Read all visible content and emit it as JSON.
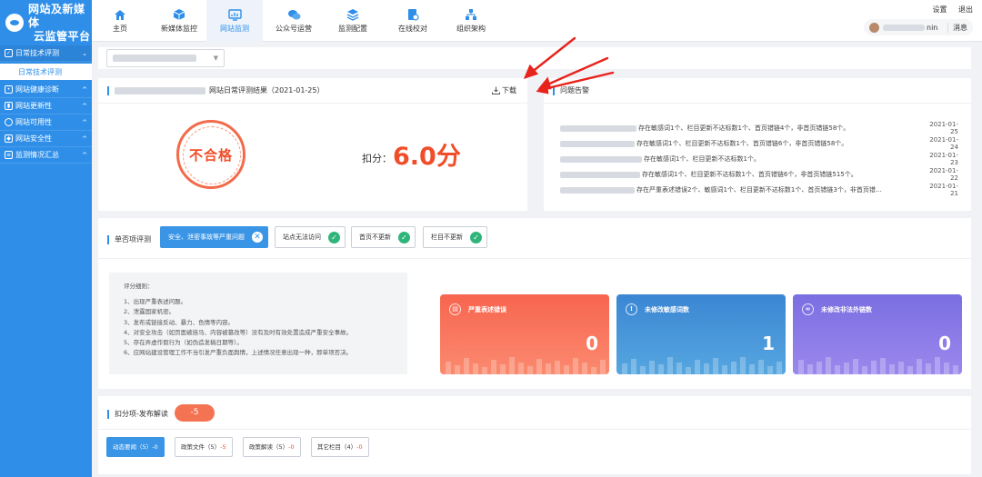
{
  "brand": {
    "line1": "网站及新媒体",
    "line2": "云监管平台"
  },
  "sidebar": {
    "groups": [
      {
        "label": "日常技术评测",
        "icon": "check-circle-icon",
        "expanded": true
      },
      {
        "label": "网站健康诊断",
        "icon": "user-icon"
      },
      {
        "label": "网站更新性",
        "icon": "chart-icon"
      },
      {
        "label": "网站可用性",
        "icon": "circle-icon"
      },
      {
        "label": "网站安全性",
        "icon": "shield-icon"
      },
      {
        "label": "监测情况汇总",
        "icon": "list-icon"
      }
    ],
    "active_sub": "日常技术评测"
  },
  "topnav": {
    "tabs": [
      {
        "label": "主页",
        "icon": "home-icon"
      },
      {
        "label": "新媒体监控",
        "icon": "cube-icon"
      },
      {
        "label": "网站监测",
        "icon": "monitor-icon",
        "active": true
      },
      {
        "label": "公众号运营",
        "icon": "wechat-icon"
      },
      {
        "label": "监测配置",
        "icon": "layers-icon"
      },
      {
        "label": "在线校对",
        "icon": "proofread-icon"
      },
      {
        "label": "组织架构",
        "icon": "org-chart-icon"
      }
    ],
    "settings": "设置",
    "logout": "退出",
    "user_suffix": "nin",
    "messages": "消息"
  },
  "result": {
    "title_suffix": "网站日常评测结果（2021-01-25）",
    "download": "下载",
    "stamp": "不合格",
    "score_label": "扣分：",
    "score_value": "6.0分"
  },
  "alerts": {
    "title": "问题告警",
    "rows": [
      {
        "text": "存在敏感词1个、栏目更新不达标数1个、首页错链4个，非首页错链58个。",
        "date": "2021-01-25"
      },
      {
        "text": "存在敏感词1个、栏目更新不达标数1个、首页错链6个，非首页错链58个。",
        "date": "2021-01-24"
      },
      {
        "text": "存在敏感词1个、栏目更新不达标数1个。",
        "date": "2021-01-23"
      },
      {
        "text": "存在敏感词1个、栏目更新不达标数1个、首页错链6个，非首页错链515个。",
        "date": "2021-01-22"
      },
      {
        "text": "存在严重表述错误2个、敏感词1个、栏目更新不达标数1个、首页错链3个，非首页错...",
        "date": "2021-01-21"
      }
    ]
  },
  "single": {
    "title": "单否项评测",
    "chips": [
      {
        "label": "安全、泄密事故等严重问题",
        "status": "fail"
      },
      {
        "label": "站点无法访问",
        "status": "pass"
      },
      {
        "label": "首页不更新",
        "status": "pass"
      },
      {
        "label": "栏目不更新",
        "status": "pass"
      }
    ],
    "rules_title": "评分细则：",
    "rules": [
      "1、出现严重表述问题。",
      "2、泄露国家机密。",
      "3、发布或链接反动、暴力、色情等内容。",
      "4、对安全攻击（如页面被挂马、内容被篡改等）没有及时有效处置造成严重安全事故。",
      "5、存在弄虚作假行为（如伪造发稿日期等）。",
      "6、应网站建设管理工作不当引发严重负面舆情，上述情况任意出现一种，即单项否决。"
    ],
    "stats": [
      {
        "label": "严重表述错误",
        "value": "0",
        "icon": "document-icon",
        "color_from": "#f56c5c",
        "color_to": "#fb8c6e"
      },
      {
        "label": "未修改敏感词数",
        "value": "1",
        "icon": "warning-icon",
        "color_from": "#3d8ad6",
        "color_to": "#52a7e2"
      },
      {
        "label": "未修改非法外链数",
        "value": "0",
        "icon": "link-icon",
        "color_from": "#7b6fe2",
        "color_to": "#9a87ec"
      }
    ]
  },
  "deduct": {
    "title": "扣分项-发布解读",
    "badge": "-5",
    "tabs": [
      {
        "label": "动态要闻（5）",
        "score": "-0",
        "active": true
      },
      {
        "label": "政策文件（5）",
        "score": "-5"
      },
      {
        "label": "政策解读（5）",
        "score": "-0"
      },
      {
        "label": "其它栏目（4）",
        "score": "-0"
      }
    ]
  }
}
